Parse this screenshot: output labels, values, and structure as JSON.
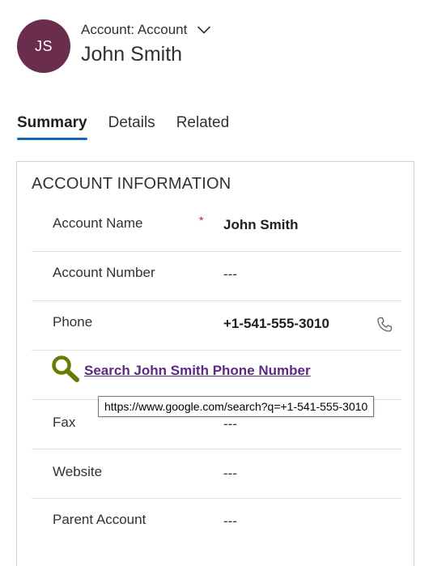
{
  "header": {
    "avatar_initials": "JS",
    "avatar_color": "#6b2d4e",
    "entity_line": "Account: Account",
    "record_name": "John Smith"
  },
  "tabs": [
    {
      "label": "Summary",
      "active": true
    },
    {
      "label": "Details",
      "active": false
    },
    {
      "label": "Related",
      "active": false
    }
  ],
  "section": {
    "title": "ACCOUNT INFORMATION",
    "fields": {
      "account_name": {
        "label": "Account Name",
        "required_marker": "*",
        "value": "John Smith"
      },
      "account_number": {
        "label": "Account Number",
        "value": "---"
      },
      "phone": {
        "label": "Phone",
        "value": "+1-541-555-3010"
      },
      "fax": {
        "label": "Fax",
        "value": "---"
      },
      "website": {
        "label": "Website",
        "value": "---"
      },
      "parent_account": {
        "label": "Parent Account",
        "value": "---"
      }
    }
  },
  "search_link": {
    "text": "Search John Smith Phone Number",
    "tooltip": "https://www.google.com/search?q=+1-541-555-3010",
    "icon": "magnifier-icon",
    "icon_color": "#6b7a00"
  },
  "colors": {
    "tab_underline": "#0f6cbd",
    "link": "#5b2a86",
    "required": "#a4262c"
  }
}
